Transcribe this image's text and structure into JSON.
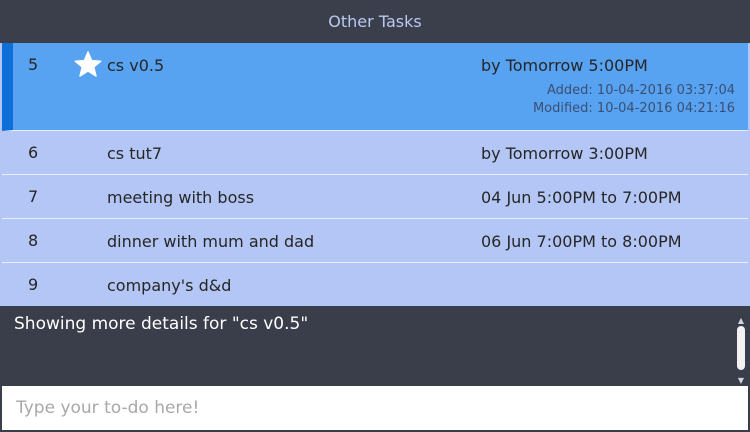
{
  "header": {
    "title": "Other Tasks"
  },
  "tasks": [
    {
      "num": "5",
      "title": "cs v0.5",
      "time": "by Tomorrow 5:00PM",
      "added": "Added: 10-04-2016 03:37:04",
      "modified": "Modified: 10-04-2016 04:21:16",
      "starred": true,
      "selected": true
    },
    {
      "num": "6",
      "title": "cs tut7",
      "time": "by Tomorrow 3:00PM"
    },
    {
      "num": "7",
      "title": "meeting with boss",
      "time": "04 Jun 5:00PM to 7:00PM"
    },
    {
      "num": "8",
      "title": "dinner with mum and dad",
      "time": "06 Jun 7:00PM to 8:00PM"
    },
    {
      "num": "9",
      "title": "company's d&d",
      "time": ""
    }
  ],
  "details": {
    "text": "Showing more details for \"cs v0.5\""
  },
  "input": {
    "placeholder": "Type your to-do here!",
    "value": ""
  },
  "colors": {
    "selected_bg": "#58a2f2",
    "selected_accent": "#0d6fd7",
    "row_bg": "#b3c6f5",
    "header_text": "#b9c9f2",
    "dark_bg": "#3a3d4a"
  },
  "icons": {
    "star": "star-icon",
    "scroll_up": "scroll-up-arrow-icon",
    "scroll_down": "scroll-down-arrow-icon"
  }
}
